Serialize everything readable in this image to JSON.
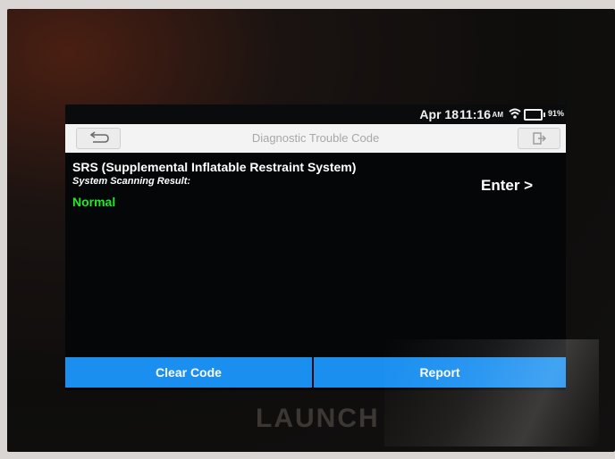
{
  "status_bar": {
    "date": "Apr 18",
    "time": "11:16",
    "ampm": "AM",
    "battery": "91%",
    "icons": [
      "wifi-icon",
      "battery-icon"
    ]
  },
  "header": {
    "title": "Diagnostic Trouble Code",
    "back_icon": "return-arrow-icon",
    "exit_icon": "exit-icon"
  },
  "system": {
    "name": "SRS (Supplemental Inflatable Restraint System)",
    "scan_label": "System Scanning Result:",
    "scan_result": "Normal",
    "enter_label": "Enter >"
  },
  "actions": {
    "clear_code": "Clear Code",
    "report": "Report"
  },
  "device": {
    "brand": "LAUNCH"
  },
  "colors": {
    "accent": "#1a8ff0",
    "status_ok": "#1fea28",
    "screen_bg": "#050607",
    "header_bg": "#f3f3f3"
  }
}
